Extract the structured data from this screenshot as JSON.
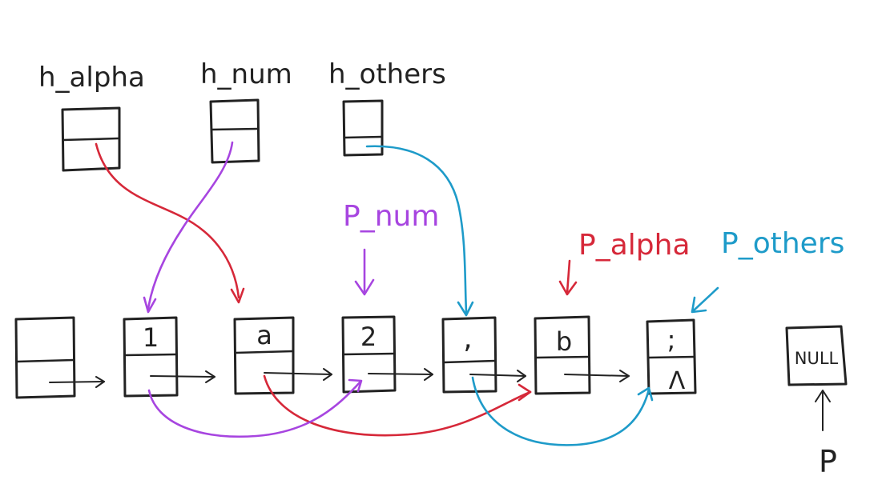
{
  "colors": {
    "ink": "#222222",
    "alpha": "#d62839",
    "num": "#a745e0",
    "others": "#1e9bc9"
  },
  "heads": {
    "alpha": "h_alpha",
    "num": "h_num",
    "others": "h_others"
  },
  "nodes": [
    "",
    "1",
    "a",
    "2",
    ",",
    "b",
    ";"
  ],
  "null_marker": "Λ",
  "null_box": "NULL",
  "pointers": {
    "p_num": "P_num",
    "p_alpha": "P_alpha",
    "p_others": "P_others",
    "p": "P"
  }
}
